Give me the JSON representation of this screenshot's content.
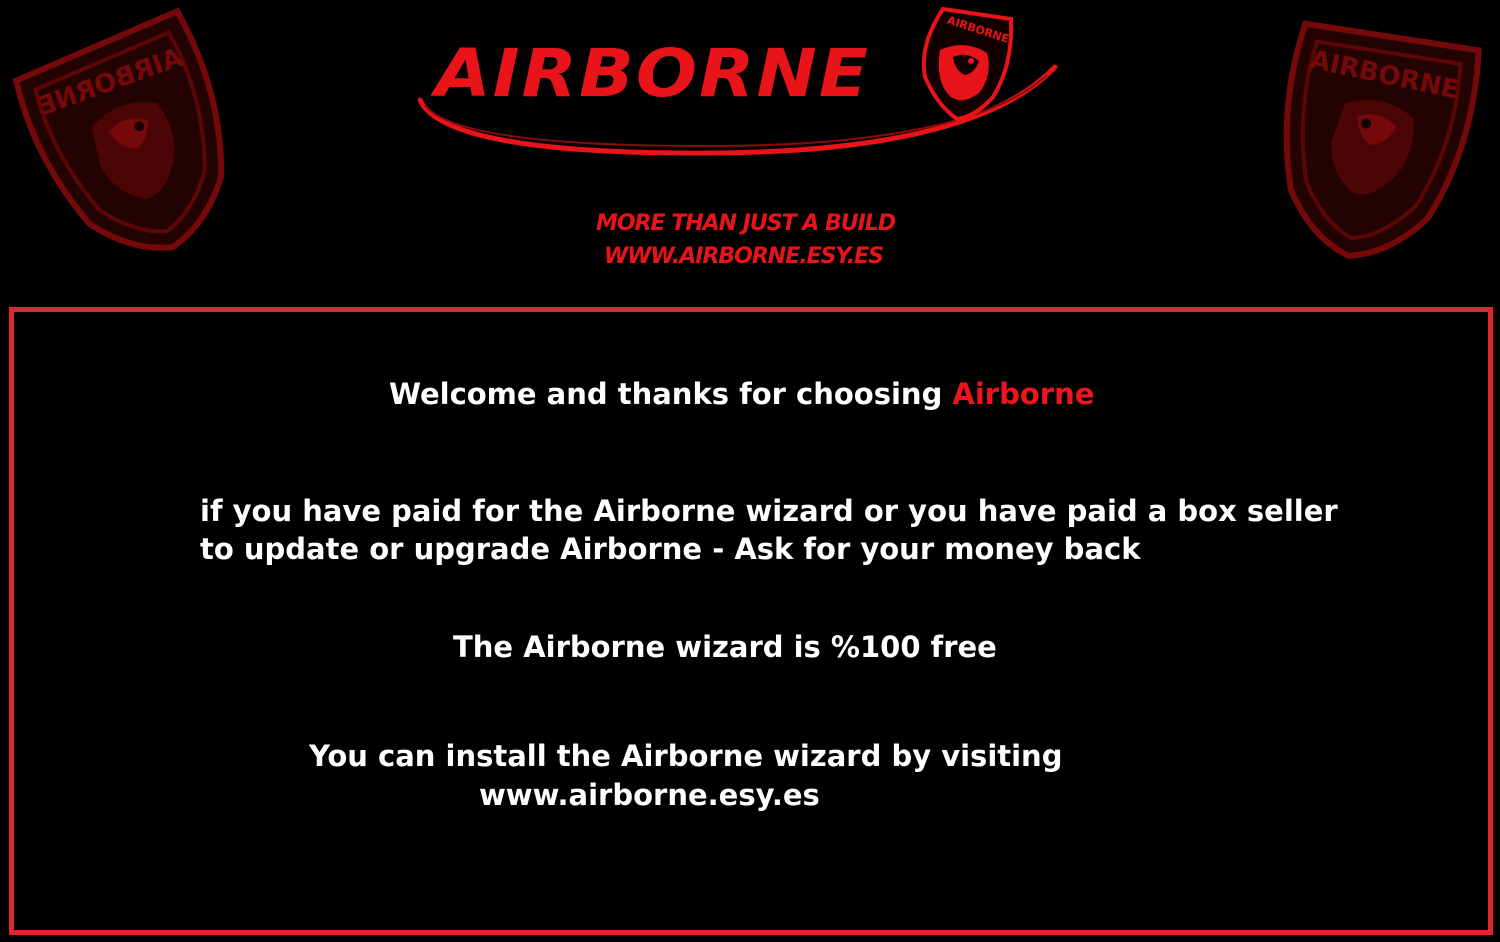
{
  "header": {
    "logo_text": "AIRBORNE",
    "badge_text": "AIRBORNE",
    "tagline_line1": "MORE THAN JUST A BUILD",
    "tagline_line2": "WWW.AIRBORNE.ESY.ES",
    "emblem_left_text": "AIRBORNE",
    "emblem_right_text": "AIRBORNE"
  },
  "content": {
    "welcome_prefix": "Welcome and thanks for choosing ",
    "welcome_brand": "Airborne",
    "paid_line1": "if you have paid for the Airborne wizard or you have paid a box seller",
    "paid_line2": "to update or upgrade Airborne - Ask for your money back",
    "free_line": "The Airborne wizard is %100 free",
    "install_line1": "You can install the Airborne wizard by visiting",
    "install_line2": "www.airborne.esy.es"
  },
  "colors": {
    "brand_red": "#e8141a",
    "frame_red": "#e0252d",
    "emblem_red": "#7a0a0a",
    "background": "#000000",
    "text": "#ffffff"
  },
  "icons": {
    "emblem": "eagle-shield-icon",
    "badge": "eagle-badge-icon"
  }
}
